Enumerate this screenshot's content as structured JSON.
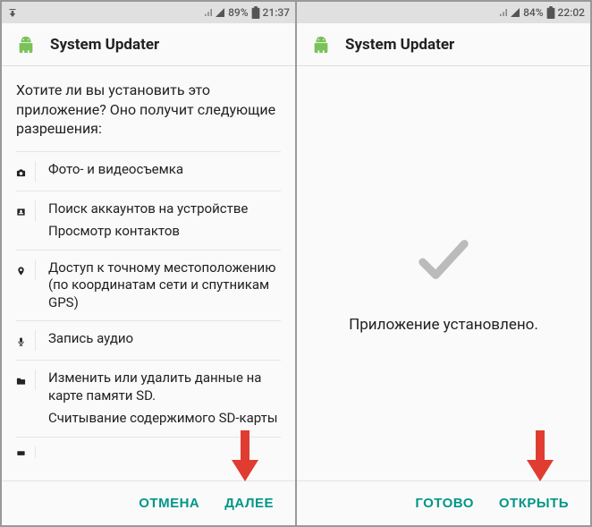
{
  "left": {
    "statusbar": {
      "battery_pct": "89%",
      "time": "21:37"
    },
    "header": {
      "title": "System Updater"
    },
    "prompt": "Хотите ли вы установить это приложение? Оно получит следующие разрешения:",
    "permissions": [
      {
        "icon": "camera",
        "lines": [
          "Фото- и видеосъемка"
        ]
      },
      {
        "icon": "contacts",
        "lines": [
          "Поиск аккаунтов на устройстве",
          "Просмотр контактов"
        ]
      },
      {
        "icon": "location",
        "lines": [
          "Доступ к точному местоположению (по координатам сети и спутникам GPS)"
        ]
      },
      {
        "icon": "microphone",
        "lines": [
          "Запись аудио"
        ]
      },
      {
        "icon": "folder",
        "lines": [
          "Изменить или удалить данные на карте памяти SD.",
          "Считывание содержимого SD-карты"
        ]
      }
    ],
    "footer": {
      "cancel": "ОТМЕНА",
      "next": "ДАЛЕЕ"
    }
  },
  "right": {
    "statusbar": {
      "battery_pct": "84%",
      "time": "22:02"
    },
    "header": {
      "title": "System Updater"
    },
    "installed_message": "Приложение установлено.",
    "footer": {
      "done": "ГОТОВО",
      "open": "ОТКРЫТЬ"
    }
  },
  "colors": {
    "accent": "#009688",
    "arrow": "#e03c31"
  }
}
